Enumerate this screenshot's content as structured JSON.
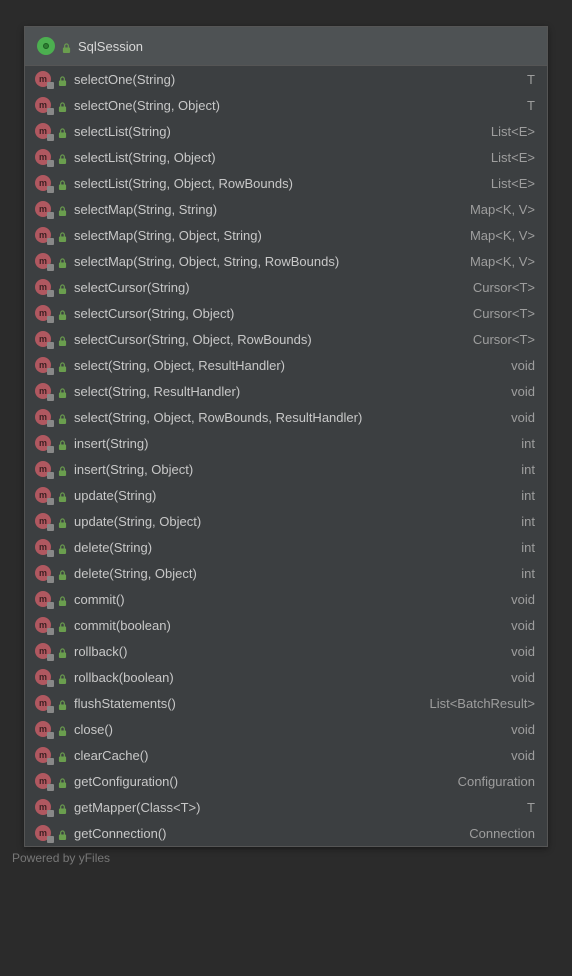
{
  "header": {
    "title": "SqlSession"
  },
  "methods": [
    {
      "name": "selectOne(String)",
      "returnType": "T"
    },
    {
      "name": "selectOne(String, Object)",
      "returnType": "T"
    },
    {
      "name": "selectList(String)",
      "returnType": "List<E>"
    },
    {
      "name": "selectList(String, Object)",
      "returnType": "List<E>"
    },
    {
      "name": "selectList(String, Object, RowBounds)",
      "returnType": "List<E>"
    },
    {
      "name": "selectMap(String, String)",
      "returnType": "Map<K, V>"
    },
    {
      "name": "selectMap(String, Object, String)",
      "returnType": "Map<K, V>"
    },
    {
      "name": "selectMap(String, Object, String, RowBounds)",
      "returnType": "Map<K, V>"
    },
    {
      "name": "selectCursor(String)",
      "returnType": "Cursor<T>"
    },
    {
      "name": "selectCursor(String, Object)",
      "returnType": "Cursor<T>"
    },
    {
      "name": "selectCursor(String, Object, RowBounds)",
      "returnType": "Cursor<T>"
    },
    {
      "name": "select(String, Object, ResultHandler)",
      "returnType": "void"
    },
    {
      "name": "select(String, ResultHandler)",
      "returnType": "void"
    },
    {
      "name": "select(String, Object, RowBounds, ResultHandler)",
      "returnType": "void"
    },
    {
      "name": "insert(String)",
      "returnType": "int"
    },
    {
      "name": "insert(String, Object)",
      "returnType": "int"
    },
    {
      "name": "update(String)",
      "returnType": "int"
    },
    {
      "name": "update(String, Object)",
      "returnType": "int"
    },
    {
      "name": "delete(String)",
      "returnType": "int"
    },
    {
      "name": "delete(String, Object)",
      "returnType": "int"
    },
    {
      "name": "commit()",
      "returnType": "void"
    },
    {
      "name": "commit(boolean)",
      "returnType": "void"
    },
    {
      "name": "rollback()",
      "returnType": "void"
    },
    {
      "name": "rollback(boolean)",
      "returnType": "void"
    },
    {
      "name": "flushStatements()",
      "returnType": "List<BatchResult>"
    },
    {
      "name": "close()",
      "returnType": "void"
    },
    {
      "name": "clearCache()",
      "returnType": "void"
    },
    {
      "name": "getConfiguration()",
      "returnType": "Configuration"
    },
    {
      "name": "getMapper(Class<T>)",
      "returnType": "T"
    },
    {
      "name": "getConnection()",
      "returnType": "Connection"
    }
  ],
  "footer": {
    "text": "Powered by yFiles"
  },
  "icons": {
    "methodLetter": "m"
  }
}
